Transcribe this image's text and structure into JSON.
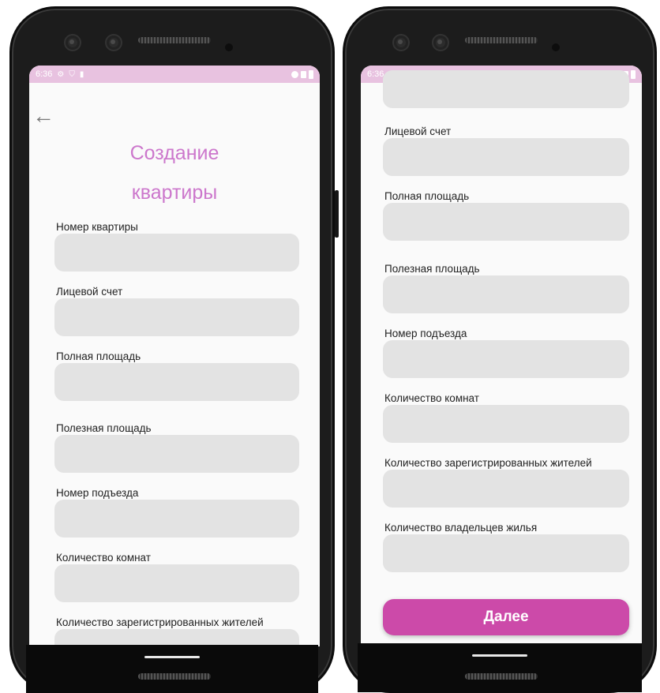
{
  "status": {
    "time": "6:36",
    "gear_icon": "⚙",
    "shield_icon": "⛉",
    "sd_icon": "▮"
  },
  "screen1": {
    "back_icon": "←",
    "title_line1": "Создание",
    "title_line2": "квартиры",
    "fields": [
      "Номер квартиры",
      "Лицевой счет",
      "Полная площадь",
      "Полезная площадь",
      "Номер подъезда",
      "Количество комнат",
      "Количество зарегистрированных жителей"
    ]
  },
  "screen2": {
    "fields": [
      "Лицевой счет",
      "Полная площадь",
      "Полезная площадь",
      "Номер подъезда",
      "Количество комнат",
      "Количество зарегистрированных жителей",
      "Количество владельцев жилья"
    ],
    "next_label": "Далее"
  },
  "colors": {
    "status_bar": "#e8c2e0",
    "title": "#cc77cc",
    "button": "#cc4aa9",
    "input_bg": "#e3e3e3"
  }
}
